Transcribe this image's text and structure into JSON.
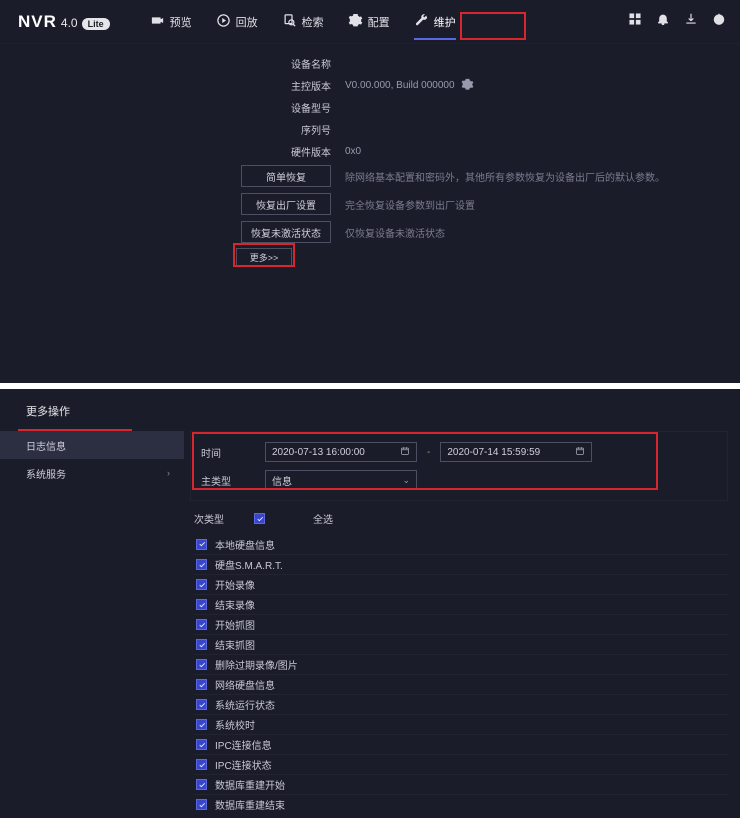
{
  "brand": {
    "name": "NVR",
    "version": "4.0",
    "edition": "Lite"
  },
  "nav": {
    "preview": "预览",
    "playback": "回放",
    "search": "检索",
    "config": "配置",
    "maint": "维护"
  },
  "info": {
    "deviceName_lbl": "设备名称",
    "fwVer_lbl": "主控版本",
    "fwVer_val": "V0.00.000, Build 000000",
    "model_lbl": "设备型号",
    "serial_lbl": "序列号",
    "hwVer_lbl": "硬件版本",
    "hwVer_val": "0x0"
  },
  "buttons": {
    "simpleRestore": "简单恢复",
    "simpleRestore_desc": "除网络基本配置和密码外，其他所有参数恢复为设备出厂后的默认参数。",
    "factoryRestore": "恢复出厂设置",
    "factoryRestore_desc": "完全恢复设备参数到出厂设置",
    "inactiveRestore": "恢复未激活状态",
    "inactiveRestore_desc": "仅恢复设备未激活状态",
    "more": "更多>>"
  },
  "moreOps": {
    "title": "更多操作",
    "sidebar": {
      "log": "日志信息",
      "sysServ": "系统服务"
    },
    "filter": {
      "time_lbl": "时间",
      "from": "2020-07-13 16:00:00",
      "to": "2020-07-14 15:59:59",
      "mainType_lbl": "主类型",
      "mainType_val": "信息",
      "subType_lbl": "次类型",
      "selectAll": "全选"
    },
    "checks": [
      "本地硬盘信息",
      "硬盘S.M.A.R.T.",
      "开始录像",
      "结束录像",
      "开始抓图",
      "结束抓图",
      "删除过期录像/图片",
      "网络硬盘信息",
      "系统运行状态",
      "系统校时",
      "IPC连接信息",
      "IPC连接状态",
      "数据库重建开始",
      "数据库重建结束"
    ]
  }
}
